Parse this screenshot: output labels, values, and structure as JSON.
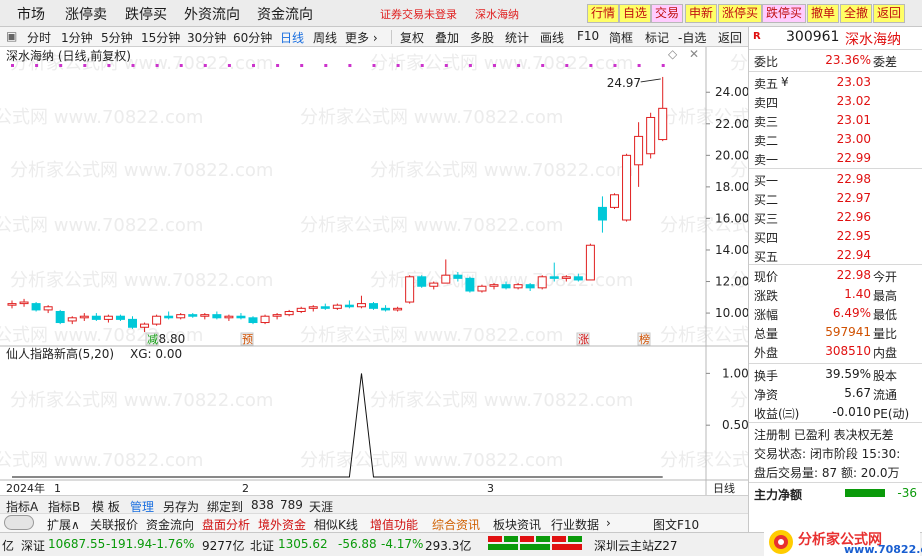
{
  "topbar": {
    "menus": [
      "市场",
      "涨停卖",
      "跌停买",
      "外资流向",
      "资金流向"
    ],
    "status_text": "证券交易未登录",
    "status_name": "深水海纳",
    "buttons": [
      "行情",
      "自选",
      "交易",
      "申新",
      "涨停买",
      "跌停买",
      "撤单",
      "全撤",
      "返回"
    ]
  },
  "toolbar": {
    "periods": [
      "分时",
      "1分钟",
      "5分钟",
      "15分钟",
      "30分钟",
      "60分钟",
      "日线",
      "周线",
      "更多 ›"
    ],
    "active_period": "日线",
    "tools": [
      "复权",
      "叠加",
      "多股",
      "统计",
      "画线",
      "F10",
      "简框",
      "标记",
      "-自选",
      "返回"
    ]
  },
  "chart": {
    "title": "深水海纳 (日线,前复权)",
    "high_label": "24.97",
    "low_label": "8.80",
    "markers": [
      "减",
      "预",
      "涨",
      "榜"
    ],
    "indicator_title": "仙人指路新高(5,20)",
    "indicator_value": "XG: 0.00",
    "date_labels": [
      "2024年",
      "1",
      "2",
      "3"
    ],
    "period_tag": "日线",
    "watermark": "分析家公式网 www.70822.com",
    "colors": {
      "up": "#e02020",
      "down": "#00c8d8",
      "dot": "#cc33cc"
    }
  },
  "chart_data": {
    "type": "candlestick",
    "ylim": [
      8.8,
      25.6
    ],
    "y_ticks": [
      "24.00",
      "22.00",
      "20.00",
      "18.00",
      "16.00",
      "14.00",
      "12.00",
      "10.00"
    ],
    "candles": [
      {
        "o": 10.5,
        "h": 10.8,
        "l": 10.3,
        "c": 10.6
      },
      {
        "o": 10.6,
        "h": 10.9,
        "l": 10.4,
        "c": 10.7
      },
      {
        "o": 10.6,
        "h": 10.7,
        "l": 10.1,
        "c": 10.2
      },
      {
        "o": 10.2,
        "h": 10.5,
        "l": 10.0,
        "c": 10.4
      },
      {
        "o": 10.1,
        "h": 10.2,
        "l": 9.3,
        "c": 9.4
      },
      {
        "o": 9.5,
        "h": 9.8,
        "l": 9.3,
        "c": 9.7
      },
      {
        "o": 9.7,
        "h": 10.0,
        "l": 9.5,
        "c": 9.8
      },
      {
        "o": 9.8,
        "h": 10.0,
        "l": 9.5,
        "c": 9.6
      },
      {
        "o": 9.6,
        "h": 9.9,
        "l": 9.4,
        "c": 9.8
      },
      {
        "o": 9.8,
        "h": 9.9,
        "l": 9.5,
        "c": 9.6
      },
      {
        "o": 9.6,
        "h": 9.8,
        "l": 9.0,
        "c": 9.1
      },
      {
        "o": 9.1,
        "h": 9.4,
        "l": 8.8,
        "c": 9.3
      },
      {
        "o": 9.3,
        "h": 9.9,
        "l": 9.2,
        "c": 9.8
      },
      {
        "o": 9.8,
        "h": 10.1,
        "l": 9.6,
        "c": 9.7
      },
      {
        "o": 9.7,
        "h": 10.0,
        "l": 9.6,
        "c": 9.9
      },
      {
        "o": 9.9,
        "h": 10.0,
        "l": 9.7,
        "c": 9.8
      },
      {
        "o": 9.8,
        "h": 10.0,
        "l": 9.6,
        "c": 9.9
      },
      {
        "o": 9.9,
        "h": 10.1,
        "l": 9.6,
        "c": 9.7
      },
      {
        "o": 9.7,
        "h": 9.9,
        "l": 9.5,
        "c": 9.8
      },
      {
        "o": 9.8,
        "h": 10.0,
        "l": 9.6,
        "c": 9.7
      },
      {
        "o": 9.7,
        "h": 9.8,
        "l": 9.3,
        "c": 9.4
      },
      {
        "o": 9.4,
        "h": 9.9,
        "l": 9.3,
        "c": 9.8
      },
      {
        "o": 9.8,
        "h": 10.0,
        "l": 9.6,
        "c": 9.9
      },
      {
        "o": 9.9,
        "h": 10.2,
        "l": 9.8,
        "c": 10.1
      },
      {
        "o": 10.1,
        "h": 10.4,
        "l": 10.0,
        "c": 10.3
      },
      {
        "o": 10.3,
        "h": 10.5,
        "l": 10.1,
        "c": 10.4
      },
      {
        "o": 10.4,
        "h": 10.6,
        "l": 10.2,
        "c": 10.3
      },
      {
        "o": 10.3,
        "h": 10.6,
        "l": 10.2,
        "c": 10.5
      },
      {
        "o": 10.5,
        "h": 10.8,
        "l": 10.3,
        "c": 10.4
      },
      {
        "o": 10.4,
        "h": 11.1,
        "l": 10.3,
        "c": 10.6
      },
      {
        "o": 10.6,
        "h": 10.7,
        "l": 10.2,
        "c": 10.3
      },
      {
        "o": 10.3,
        "h": 10.5,
        "l": 10.1,
        "c": 10.2
      },
      {
        "o": 10.2,
        "h": 10.4,
        "l": 10.1,
        "c": 10.3
      },
      {
        "o": 10.7,
        "h": 12.4,
        "l": 10.6,
        "c": 12.3
      },
      {
        "o": 12.3,
        "h": 12.4,
        "l": 11.6,
        "c": 11.7
      },
      {
        "o": 11.7,
        "h": 12.0,
        "l": 11.5,
        "c": 11.9
      },
      {
        "o": 11.9,
        "h": 13.4,
        "l": 11.9,
        "c": 12.4
      },
      {
        "o": 12.4,
        "h": 12.6,
        "l": 12.0,
        "c": 12.2
      },
      {
        "o": 12.2,
        "h": 12.3,
        "l": 11.3,
        "c": 11.4
      },
      {
        "o": 11.4,
        "h": 11.8,
        "l": 11.3,
        "c": 11.7
      },
      {
        "o": 11.7,
        "h": 11.9,
        "l": 11.5,
        "c": 11.8
      },
      {
        "o": 11.8,
        "h": 12.0,
        "l": 11.5,
        "c": 11.6
      },
      {
        "o": 11.6,
        "h": 11.9,
        "l": 11.5,
        "c": 11.8
      },
      {
        "o": 11.8,
        "h": 11.9,
        "l": 11.4,
        "c": 11.6
      },
      {
        "o": 11.6,
        "h": 12.4,
        "l": 11.5,
        "c": 12.3
      },
      {
        "o": 12.3,
        "h": 13.2,
        "l": 12.0,
        "c": 12.2
      },
      {
        "o": 12.2,
        "h": 12.4,
        "l": 12.0,
        "c": 12.3
      },
      {
        "o": 12.3,
        "h": 12.5,
        "l": 12.0,
        "c": 12.1
      },
      {
        "o": 12.1,
        "h": 14.4,
        "l": 12.1,
        "c": 14.3
      },
      {
        "o": 16.7,
        "h": 17.4,
        "l": 15.1,
        "c": 15.9
      },
      {
        "o": 16.7,
        "h": 17.6,
        "l": 16.6,
        "c": 17.5
      },
      {
        "o": 15.9,
        "h": 20.1,
        "l": 15.8,
        "c": 20.0
      },
      {
        "o": 19.4,
        "h": 22.1,
        "l": 18.0,
        "c": 21.2
      },
      {
        "o": 20.1,
        "h": 22.7,
        "l": 19.8,
        "c": 22.4
      },
      {
        "o": 21.0,
        "h": 24.97,
        "l": 20.9,
        "c": 22.98
      }
    ],
    "indicator": {
      "name": "仙人指路新高(5,20)",
      "ylim": [
        0,
        1.1
      ],
      "y_ticks": [
        "1.00",
        "0.50"
      ],
      "values": [
        0,
        0,
        0,
        0,
        0,
        0,
        0,
        0,
        0,
        0,
        0,
        0,
        0,
        0,
        0,
        0,
        0,
        0,
        0,
        0,
        0,
        0,
        0,
        0,
        0,
        0,
        0,
        0,
        0,
        1,
        0,
        0,
        0,
        0,
        0,
        0,
        0,
        0,
        0,
        0,
        0,
        0,
        0,
        0,
        0,
        0,
        0,
        0,
        0,
        0,
        0,
        0,
        0,
        0,
        0
      ]
    }
  },
  "quote": {
    "code": "300961",
    "name": "深水海纳",
    "webi_label": "委比",
    "webi_value": "23.36%",
    "weicha_label": "委差",
    "asks": [
      {
        "label": "卖五",
        "unit": "¥",
        "price": "23.03"
      },
      {
        "label": "卖四",
        "price": "23.02"
      },
      {
        "label": "卖三",
        "price": "23.01"
      },
      {
        "label": "卖二",
        "price": "23.00"
      },
      {
        "label": "卖一",
        "price": "22.99"
      }
    ],
    "bids": [
      {
        "label": "买一",
        "price": "22.98"
      },
      {
        "label": "买二",
        "price": "22.97"
      },
      {
        "label": "买三",
        "price": "22.96"
      },
      {
        "label": "买四",
        "price": "22.95"
      },
      {
        "label": "买五",
        "price": "22.94"
      }
    ],
    "stats": [
      {
        "label": "现价",
        "value": "22.98",
        "label2": "今开",
        "color": "red"
      },
      {
        "label": "涨跌",
        "value": "1.40",
        "label2": "最高",
        "color": "red"
      },
      {
        "label": "涨幅",
        "value": "6.49%",
        "label2": "最低",
        "color": "red"
      },
      {
        "label": "总量",
        "value": "597941",
        "label2": "量比",
        "color": "org"
      },
      {
        "label": "外盘",
        "value": "308510",
        "label2": "内盘",
        "color": "red"
      }
    ],
    "stats2": [
      {
        "label": "换手",
        "value": "39.59%",
        "label2": "股本"
      },
      {
        "label": "净资",
        "value": "5.67",
        "label2": "流通"
      },
      {
        "label": "收益(㈢)",
        "value": "-0.010",
        "label2": "PE(动)"
      }
    ],
    "info": [
      "注册制 已盈利 表决权无差",
      "交易状态: 闭市阶段 15:30:",
      "盘后交易量: 87  额: 20.0万"
    ],
    "main_flow_label": "主力净额",
    "main_flow_value": "-36"
  },
  "bottom": {
    "tabs1": [
      "指标A",
      "指标B",
      "模 板",
      "管理",
      "另存为",
      "绑定到",
      "838",
      "789",
      "天涯"
    ],
    "tabs1_active": "管理",
    "tabs2": [
      "扩展∧",
      "关联报价",
      "资金流向",
      "盘面分析",
      "境外资金",
      "相似K线",
      "增值功能",
      "综合资讯",
      "板块资讯",
      "行业数据",
      "›"
    ],
    "right_tab": "图文F10"
  },
  "ticker": {
    "items": [
      {
        "text": "亿",
        "cls": "b"
      },
      {
        "text": "深证",
        "cls": "b"
      },
      {
        "text": "10687.55",
        "cls": "g"
      },
      {
        "text": "-191.94",
        "cls": "g"
      },
      {
        "text": "-1.76%",
        "cls": "g"
      },
      {
        "text": "9277亿",
        "cls": "b"
      },
      {
        "text": "北证",
        "cls": "b"
      },
      {
        "text": "1305.62",
        "cls": "g"
      },
      {
        "text": "-56.88",
        "cls": "g"
      },
      {
        "text": "-4.17%",
        "cls": "g"
      },
      {
        "text": "293.3亿",
        "cls": "b"
      },
      {
        "text": "深圳云主站Z27",
        "cls": "b"
      }
    ]
  },
  "logo": {
    "brand": "分析家公式网",
    "site": "www.70822.com"
  }
}
